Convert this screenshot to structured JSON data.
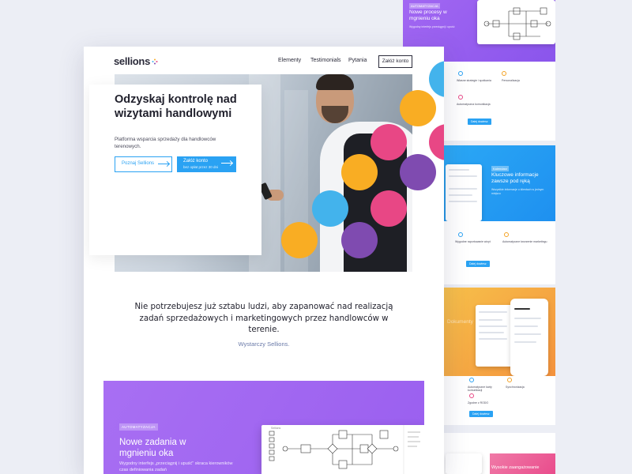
{
  "nav": {
    "logo": "sellions",
    "links": [
      "Elementy",
      "Testimonials",
      "Pytania"
    ],
    "cta": "Załóż konto"
  },
  "hero": {
    "title": "Odzyskaj kontrolę nad wizytami handlowymi",
    "subtitle": "Platforma wsparcia sprzedaży dla handlowców terenowych.",
    "btn_primary": "Poznaj Sellions",
    "btn_secondary": "Załóż konto",
    "btn_secondary_note": "bez opłat przez 30 dni"
  },
  "tagline": {
    "text": "Nie potrzebujesz już sztabu ludzi, aby zapanować nad realizacją zadań sprzedażowych i marketingowych przez handlowców w terenie.",
    "sub": "Wystarczy Sellions."
  },
  "automation": {
    "tag": "AUTOMATYZACJA",
    "title": "Nowe zadania w mgnieniu oka",
    "text": "Wygodny interfejs „przeciągnij i upuść\" skraca kierowników czas definiowania zadań",
    "screen_label": "Sellions"
  },
  "preview": {
    "top_title": "Nowe procesy w mgnieniu oka",
    "features_1": [
      "Własne strategie i spotkania",
      "Personalizacja",
      "Automatyczna komunikacja"
    ],
    "btn": "Dalej dowiesz",
    "blue_tag": "Kalendarz",
    "blue_title": "Kluczowe informacje zawsze pod ręką",
    "features_2": [
      "Wygodne raportowanie wizyt",
      "Automatyczne tworzenie marketingu"
    ],
    "orange_title": "Dokumenty",
    "features_3": [
      "Automatyczne karty komunikacji",
      "Synchronizacja",
      "Zgodne z RODO"
    ],
    "pink_title": "Wysokie zaangażowanie"
  },
  "colors": {
    "accent_blue": "#2aa2f3",
    "purple": "#9a5fef",
    "yellow": "#f9ad23",
    "sky": "#43b3ec",
    "pink": "#e84785",
    "violet": "#7f4bb0"
  }
}
